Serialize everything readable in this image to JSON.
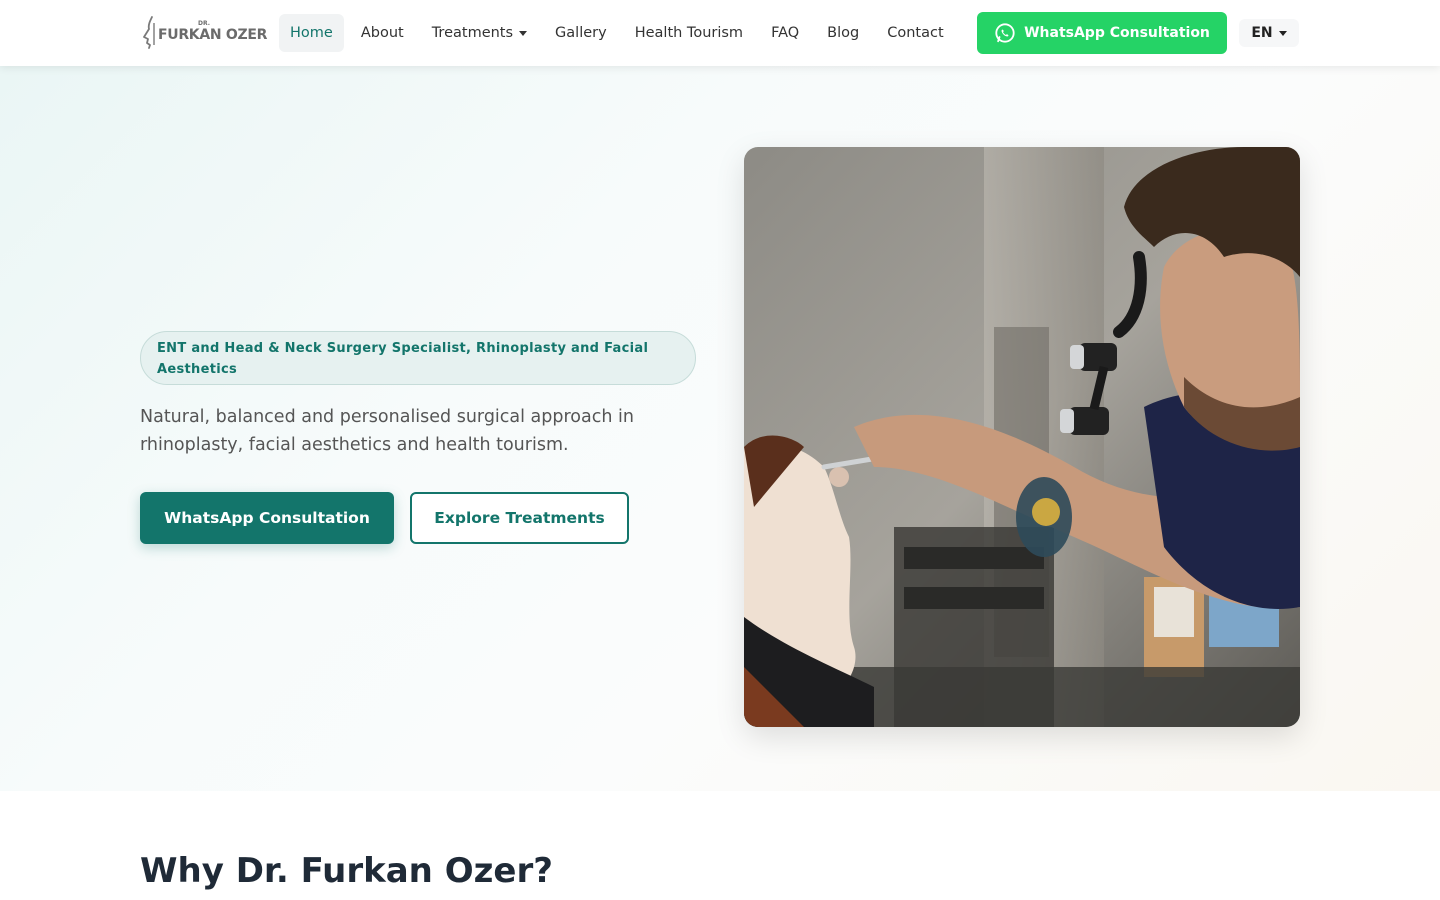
{
  "header": {
    "logo": {
      "prefix": "DR.",
      "name": "FURKAN OZER"
    },
    "nav": [
      {
        "label": "Home",
        "active": true
      },
      {
        "label": "About"
      },
      {
        "label": "Treatments",
        "dropdown": true
      },
      {
        "label": "Gallery"
      },
      {
        "label": "Health Tourism"
      },
      {
        "label": "FAQ"
      },
      {
        "label": "Blog"
      },
      {
        "label": "Contact"
      }
    ],
    "whatsapp_button": {
      "label": "WhatsApp Consultation",
      "icon": "whatsapp-icon"
    },
    "language": {
      "selected": "EN"
    }
  },
  "hero": {
    "badge": "ENT and Head & Neck Surgery Specialist, Rhinoplasty and Facial Aesthetics",
    "description": "Natural, balanced and personalised surgical approach in rhinoplasty, facial aesthetics and health tourism.",
    "primary_button": "WhatsApp Consultation",
    "secondary_button": "Explore Treatments"
  },
  "why_section": {
    "title": "Why Dr. Furkan Ozer?"
  },
  "colors": {
    "brand": "#13756b",
    "whatsapp": "#25d366",
    "heading": "#1f2a37"
  }
}
